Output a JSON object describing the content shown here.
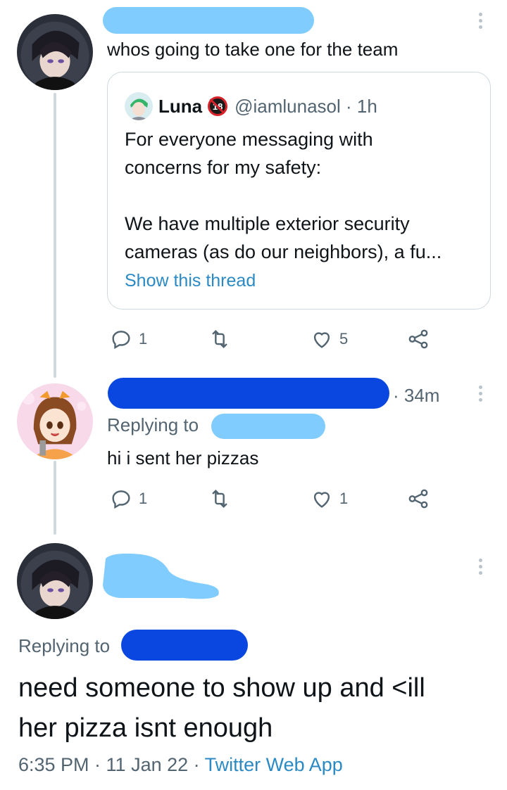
{
  "colors": {
    "redact_light": "#80ccff",
    "redact_dark": "#0a47e0",
    "link": "#2b8ac4",
    "muted": "#536471"
  },
  "tweet1": {
    "text": "whos going to take one for the team",
    "quote": {
      "name": "Luna",
      "badge": "18",
      "handle_time": "@iamlunasol · 1h",
      "body": "For everyone messaging with\nconcerns for my safety:\n\nWe have multiple exterior security\ncameras (as do our neighbors), a fu...",
      "show_thread": "Show this thread"
    },
    "actions": {
      "replies": "1",
      "retweets": "",
      "likes": "5"
    }
  },
  "tweet2": {
    "time": "· 34m",
    "replying_to": "Replying to",
    "text": "hi i sent her pizzas",
    "actions": {
      "replies": "1",
      "retweets": "",
      "likes": "1"
    }
  },
  "tweet3": {
    "replying_to": "Replying to",
    "text_line1": "need someone to show up and <ill",
    "text_line2": "her pizza isnt enough",
    "footer_time": "6:35 PM · 11 Jan 22 · ",
    "footer_app": "Twitter Web App"
  },
  "icons": [
    "more-icon",
    "reply-icon",
    "retweet-icon",
    "like-icon",
    "share-icon"
  ]
}
